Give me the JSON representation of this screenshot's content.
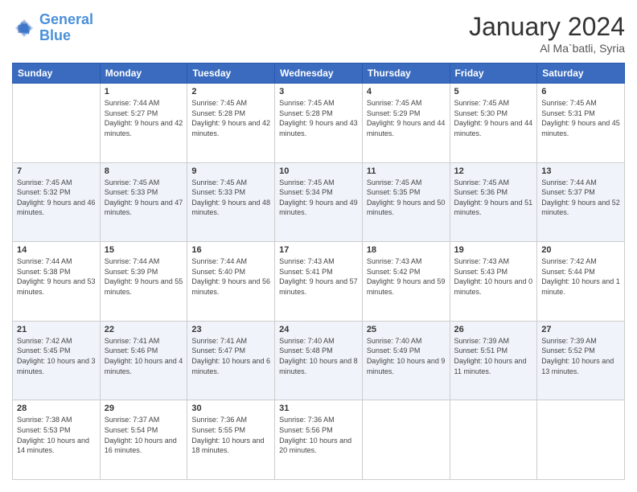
{
  "header": {
    "logo_line1": "General",
    "logo_line2": "Blue",
    "month_year": "January 2024",
    "location": "Al Ma`batli, Syria"
  },
  "days_of_week": [
    "Sunday",
    "Monday",
    "Tuesday",
    "Wednesday",
    "Thursday",
    "Friday",
    "Saturday"
  ],
  "weeks": [
    [
      {
        "day": "",
        "sunrise": "",
        "sunset": "",
        "daylight": ""
      },
      {
        "day": "1",
        "sunrise": "Sunrise: 7:44 AM",
        "sunset": "Sunset: 5:27 PM",
        "daylight": "Daylight: 9 hours and 42 minutes."
      },
      {
        "day": "2",
        "sunrise": "Sunrise: 7:45 AM",
        "sunset": "Sunset: 5:28 PM",
        "daylight": "Daylight: 9 hours and 42 minutes."
      },
      {
        "day": "3",
        "sunrise": "Sunrise: 7:45 AM",
        "sunset": "Sunset: 5:28 PM",
        "daylight": "Daylight: 9 hours and 43 minutes."
      },
      {
        "day": "4",
        "sunrise": "Sunrise: 7:45 AM",
        "sunset": "Sunset: 5:29 PM",
        "daylight": "Daylight: 9 hours and 44 minutes."
      },
      {
        "day": "5",
        "sunrise": "Sunrise: 7:45 AM",
        "sunset": "Sunset: 5:30 PM",
        "daylight": "Daylight: 9 hours and 44 minutes."
      },
      {
        "day": "6",
        "sunrise": "Sunrise: 7:45 AM",
        "sunset": "Sunset: 5:31 PM",
        "daylight": "Daylight: 9 hours and 45 minutes."
      }
    ],
    [
      {
        "day": "7",
        "sunrise": "Sunrise: 7:45 AM",
        "sunset": "Sunset: 5:32 PM",
        "daylight": "Daylight: 9 hours and 46 minutes."
      },
      {
        "day": "8",
        "sunrise": "Sunrise: 7:45 AM",
        "sunset": "Sunset: 5:33 PM",
        "daylight": "Daylight: 9 hours and 47 minutes."
      },
      {
        "day": "9",
        "sunrise": "Sunrise: 7:45 AM",
        "sunset": "Sunset: 5:33 PM",
        "daylight": "Daylight: 9 hours and 48 minutes."
      },
      {
        "day": "10",
        "sunrise": "Sunrise: 7:45 AM",
        "sunset": "Sunset: 5:34 PM",
        "daylight": "Daylight: 9 hours and 49 minutes."
      },
      {
        "day": "11",
        "sunrise": "Sunrise: 7:45 AM",
        "sunset": "Sunset: 5:35 PM",
        "daylight": "Daylight: 9 hours and 50 minutes."
      },
      {
        "day": "12",
        "sunrise": "Sunrise: 7:45 AM",
        "sunset": "Sunset: 5:36 PM",
        "daylight": "Daylight: 9 hours and 51 minutes."
      },
      {
        "day": "13",
        "sunrise": "Sunrise: 7:44 AM",
        "sunset": "Sunset: 5:37 PM",
        "daylight": "Daylight: 9 hours and 52 minutes."
      }
    ],
    [
      {
        "day": "14",
        "sunrise": "Sunrise: 7:44 AM",
        "sunset": "Sunset: 5:38 PM",
        "daylight": "Daylight: 9 hours and 53 minutes."
      },
      {
        "day": "15",
        "sunrise": "Sunrise: 7:44 AM",
        "sunset": "Sunset: 5:39 PM",
        "daylight": "Daylight: 9 hours and 55 minutes."
      },
      {
        "day": "16",
        "sunrise": "Sunrise: 7:44 AM",
        "sunset": "Sunset: 5:40 PM",
        "daylight": "Daylight: 9 hours and 56 minutes."
      },
      {
        "day": "17",
        "sunrise": "Sunrise: 7:43 AM",
        "sunset": "Sunset: 5:41 PM",
        "daylight": "Daylight: 9 hours and 57 minutes."
      },
      {
        "day": "18",
        "sunrise": "Sunrise: 7:43 AM",
        "sunset": "Sunset: 5:42 PM",
        "daylight": "Daylight: 9 hours and 59 minutes."
      },
      {
        "day": "19",
        "sunrise": "Sunrise: 7:43 AM",
        "sunset": "Sunset: 5:43 PM",
        "daylight": "Daylight: 10 hours and 0 minutes."
      },
      {
        "day": "20",
        "sunrise": "Sunrise: 7:42 AM",
        "sunset": "Sunset: 5:44 PM",
        "daylight": "Daylight: 10 hours and 1 minute."
      }
    ],
    [
      {
        "day": "21",
        "sunrise": "Sunrise: 7:42 AM",
        "sunset": "Sunset: 5:45 PM",
        "daylight": "Daylight: 10 hours and 3 minutes."
      },
      {
        "day": "22",
        "sunrise": "Sunrise: 7:41 AM",
        "sunset": "Sunset: 5:46 PM",
        "daylight": "Daylight: 10 hours and 4 minutes."
      },
      {
        "day": "23",
        "sunrise": "Sunrise: 7:41 AM",
        "sunset": "Sunset: 5:47 PM",
        "daylight": "Daylight: 10 hours and 6 minutes."
      },
      {
        "day": "24",
        "sunrise": "Sunrise: 7:40 AM",
        "sunset": "Sunset: 5:48 PM",
        "daylight": "Daylight: 10 hours and 8 minutes."
      },
      {
        "day": "25",
        "sunrise": "Sunrise: 7:40 AM",
        "sunset": "Sunset: 5:49 PM",
        "daylight": "Daylight: 10 hours and 9 minutes."
      },
      {
        "day": "26",
        "sunrise": "Sunrise: 7:39 AM",
        "sunset": "Sunset: 5:51 PM",
        "daylight": "Daylight: 10 hours and 11 minutes."
      },
      {
        "day": "27",
        "sunrise": "Sunrise: 7:39 AM",
        "sunset": "Sunset: 5:52 PM",
        "daylight": "Daylight: 10 hours and 13 minutes."
      }
    ],
    [
      {
        "day": "28",
        "sunrise": "Sunrise: 7:38 AM",
        "sunset": "Sunset: 5:53 PM",
        "daylight": "Daylight: 10 hours and 14 minutes."
      },
      {
        "day": "29",
        "sunrise": "Sunrise: 7:37 AM",
        "sunset": "Sunset: 5:54 PM",
        "daylight": "Daylight: 10 hours and 16 minutes."
      },
      {
        "day": "30",
        "sunrise": "Sunrise: 7:36 AM",
        "sunset": "Sunset: 5:55 PM",
        "daylight": "Daylight: 10 hours and 18 minutes."
      },
      {
        "day": "31",
        "sunrise": "Sunrise: 7:36 AM",
        "sunset": "Sunset: 5:56 PM",
        "daylight": "Daylight: 10 hours and 20 minutes."
      },
      {
        "day": "",
        "sunrise": "",
        "sunset": "",
        "daylight": ""
      },
      {
        "day": "",
        "sunrise": "",
        "sunset": "",
        "daylight": ""
      },
      {
        "day": "",
        "sunrise": "",
        "sunset": "",
        "daylight": ""
      }
    ]
  ]
}
